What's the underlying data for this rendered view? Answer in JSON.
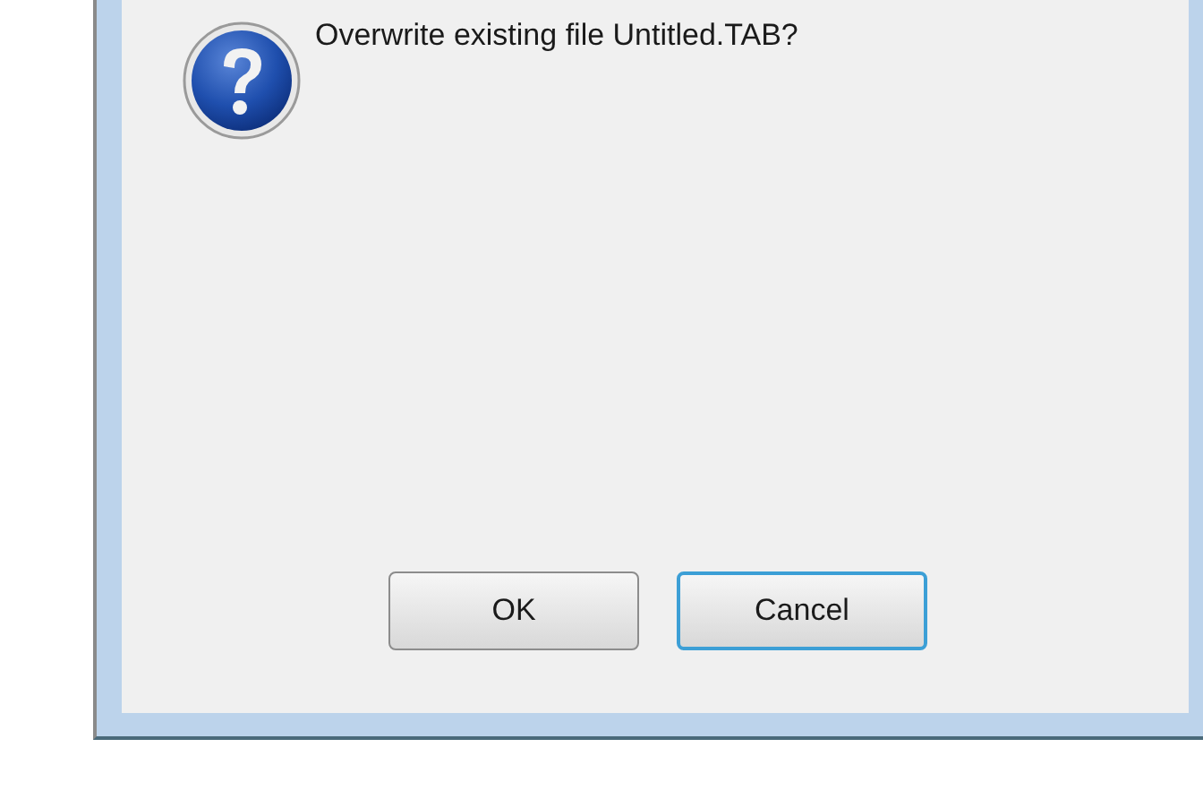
{
  "dialog": {
    "message": "Overwrite existing file Untitled.TAB?",
    "buttons": [
      {
        "label": "OK",
        "focused": false
      },
      {
        "label": "Cancel",
        "focused": true
      }
    ]
  }
}
